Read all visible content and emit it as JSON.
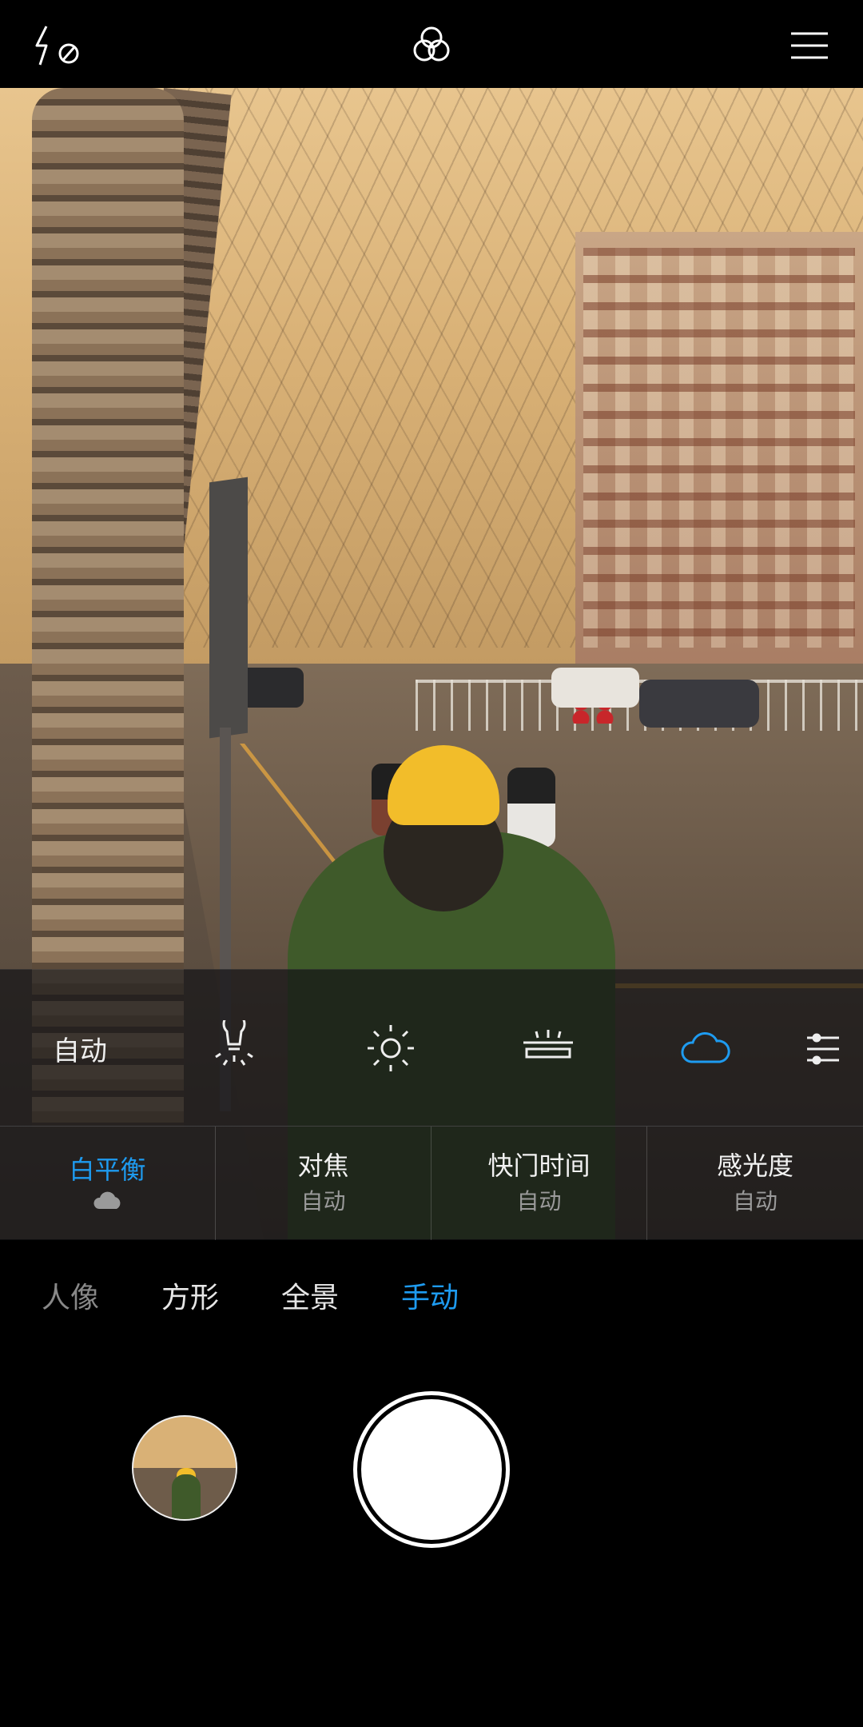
{
  "topbar": {
    "flash_icon": "flash-off-icon",
    "filters_icon": "filters-icon",
    "menu_icon": "hamburger-menu-icon"
  },
  "white_balance": {
    "options": [
      {
        "label": "自动",
        "icon": null
      },
      {
        "label": "",
        "icon": "incandescent-bulb-icon"
      },
      {
        "label": "",
        "icon": "daylight-sun-icon"
      },
      {
        "label": "",
        "icon": "fluorescent-icon"
      },
      {
        "label": "",
        "icon": "cloudy-icon"
      },
      {
        "label": "",
        "icon": "custom-adjust-icon"
      }
    ],
    "selected": "cloudy-icon"
  },
  "params": [
    {
      "title": "白平衡",
      "value_icon": "cloudy-icon",
      "active": true
    },
    {
      "title": "对焦",
      "value": "自动"
    },
    {
      "title": "快门时间",
      "value": "自动"
    },
    {
      "title": "感光度",
      "value": "自动"
    }
  ],
  "modes": [
    {
      "label": "人像"
    },
    {
      "label": "方形"
    },
    {
      "label": "全景"
    },
    {
      "label": "手动",
      "active": true
    }
  ],
  "colors": {
    "accent": "#1e9bf0",
    "background": "#000000"
  }
}
